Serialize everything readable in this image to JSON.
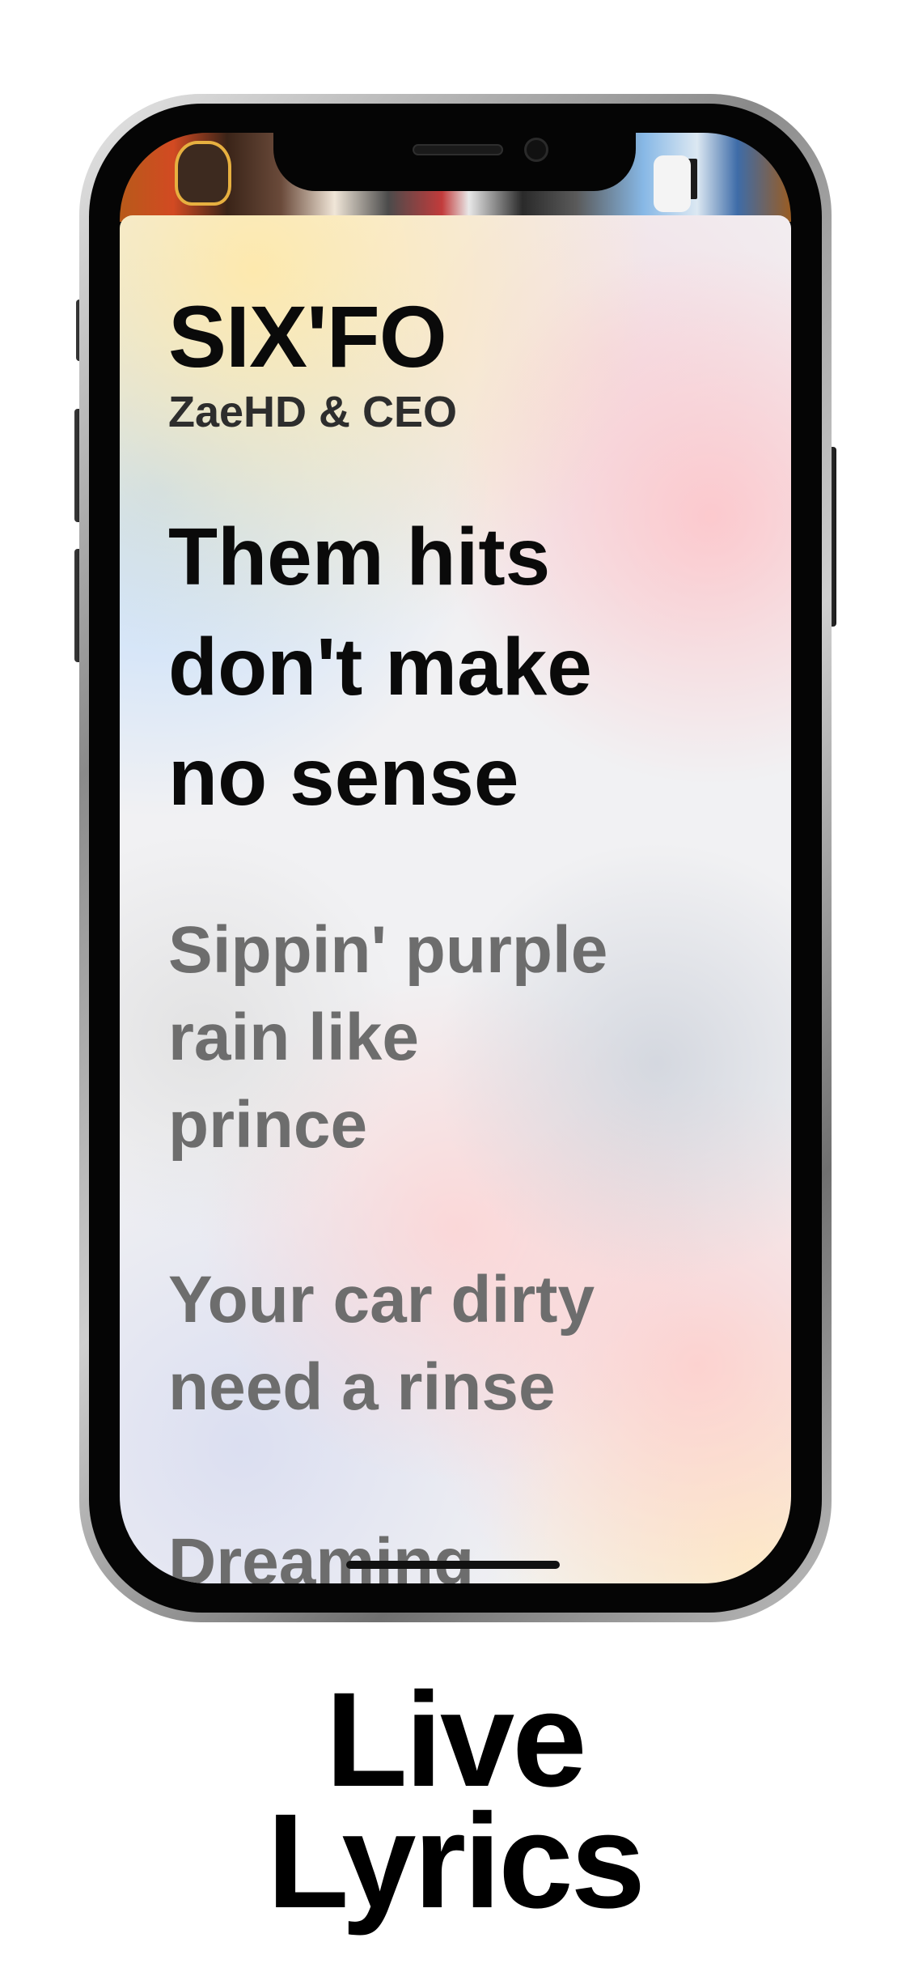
{
  "track": {
    "title": "SIX'FO",
    "artist": "ZaeHD & CEO"
  },
  "lyrics": {
    "current_line": "Them hits\ndon't make\nno sense",
    "upcoming_lines": [
      "Sippin' purple\nrain like\nprince",
      "Your car dirty\nneed a rinse",
      "Dreaming"
    ]
  },
  "caption": {
    "line1": "Live",
    "line2": "Lyrics"
  },
  "colors": {
    "current_lyric": "#0a0a0a",
    "upcoming_lyric": "#6d6d6d",
    "caption_text": "#000000",
    "background": "#ffffff"
  }
}
